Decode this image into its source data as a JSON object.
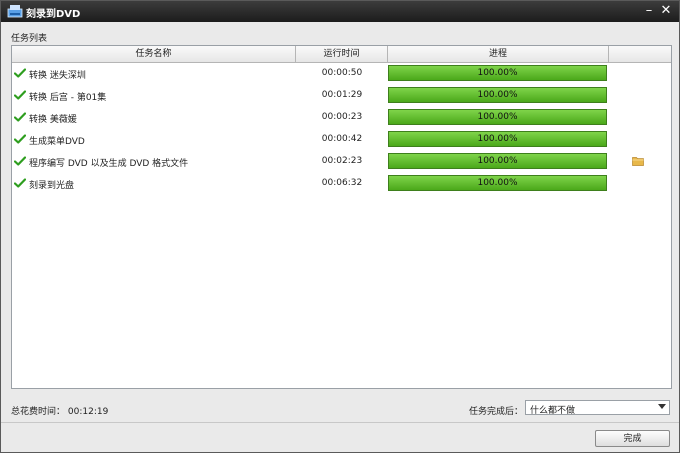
{
  "window": {
    "title": "刻录到DVD",
    "minimize_icon": "minimize-icon",
    "close_icon": "close-icon",
    "minimize_glyph": "–",
    "close_glyph": "✕"
  },
  "task_list": {
    "label": "任务列表",
    "columns": {
      "name": "任务名称",
      "runtime": "运行时间",
      "progress": "进程"
    },
    "rows": [
      {
        "name": "转换 迷失深圳",
        "runtime": "00:00:50",
        "progress_text": "100.00%",
        "progress": 1.0,
        "status_icon": "check-icon"
      },
      {
        "name": "转换 后宫 - 第01集",
        "runtime": "00:01:29",
        "progress_text": "100.00%",
        "progress": 1.0,
        "status_icon": "check-icon"
      },
      {
        "name": "转换 美薇媛",
        "runtime": "00:00:23",
        "progress_text": "100.00%",
        "progress": 1.0,
        "status_icon": "check-icon"
      },
      {
        "name": "生成菜单DVD",
        "runtime": "00:00:42",
        "progress_text": "100.00%",
        "progress": 1.0,
        "status_icon": "check-icon"
      },
      {
        "name": "程序编写 DVD 以及生成 DVD 格式文件",
        "runtime": "00:02:23",
        "progress_text": "100.00%",
        "progress": 1.0,
        "status_icon": "check-icon",
        "action_icon": "folder-icon"
      },
      {
        "name": "刻录到光盘",
        "runtime": "00:06:32",
        "progress_text": "100.00%",
        "progress": 1.0,
        "status_icon": "check-icon"
      }
    ]
  },
  "footer": {
    "total_label": "总花费时间：",
    "total_value": "00:12:19",
    "after_label": "任务完成后：",
    "after_value": "什么都不做",
    "finish_button": "完成"
  },
  "colors": {
    "titlebar": "#2a2a2a",
    "progress_green": "#5cbf2a",
    "check_green": "#2e9e1f",
    "folder": "#e8b84a"
  }
}
